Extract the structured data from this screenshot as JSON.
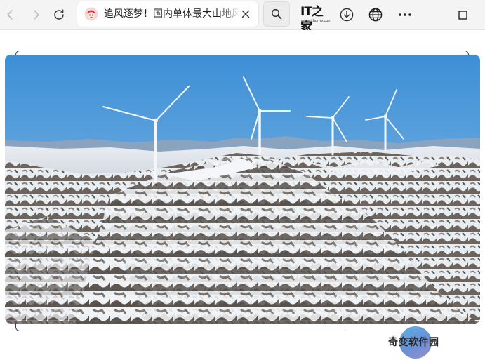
{
  "browser": {
    "tab": {
      "title": "追风逐梦！国内单体最大山地风电场"
    },
    "logo": {
      "main": "IT之家",
      "sub": "www.ithome.com"
    }
  },
  "article": {
    "image_label": ""
  },
  "watermark": {
    "text": "奇变软件园"
  },
  "colors": {
    "toolbar_bg": "#f4f4f4",
    "tab_bg": "#ffffff",
    "sky_top": "#3d8fd6",
    "sky_bottom": "#a9cfe9",
    "snow": "#eef2f6",
    "rock": "#5c5650"
  },
  "icons": [
    "back-arrow-icon",
    "forward-arrow-icon",
    "refresh-icon",
    "favicon-icon",
    "close-icon",
    "search-icon",
    "download-icon",
    "globe-icon",
    "more-icon",
    "window-maximize-icon"
  ]
}
